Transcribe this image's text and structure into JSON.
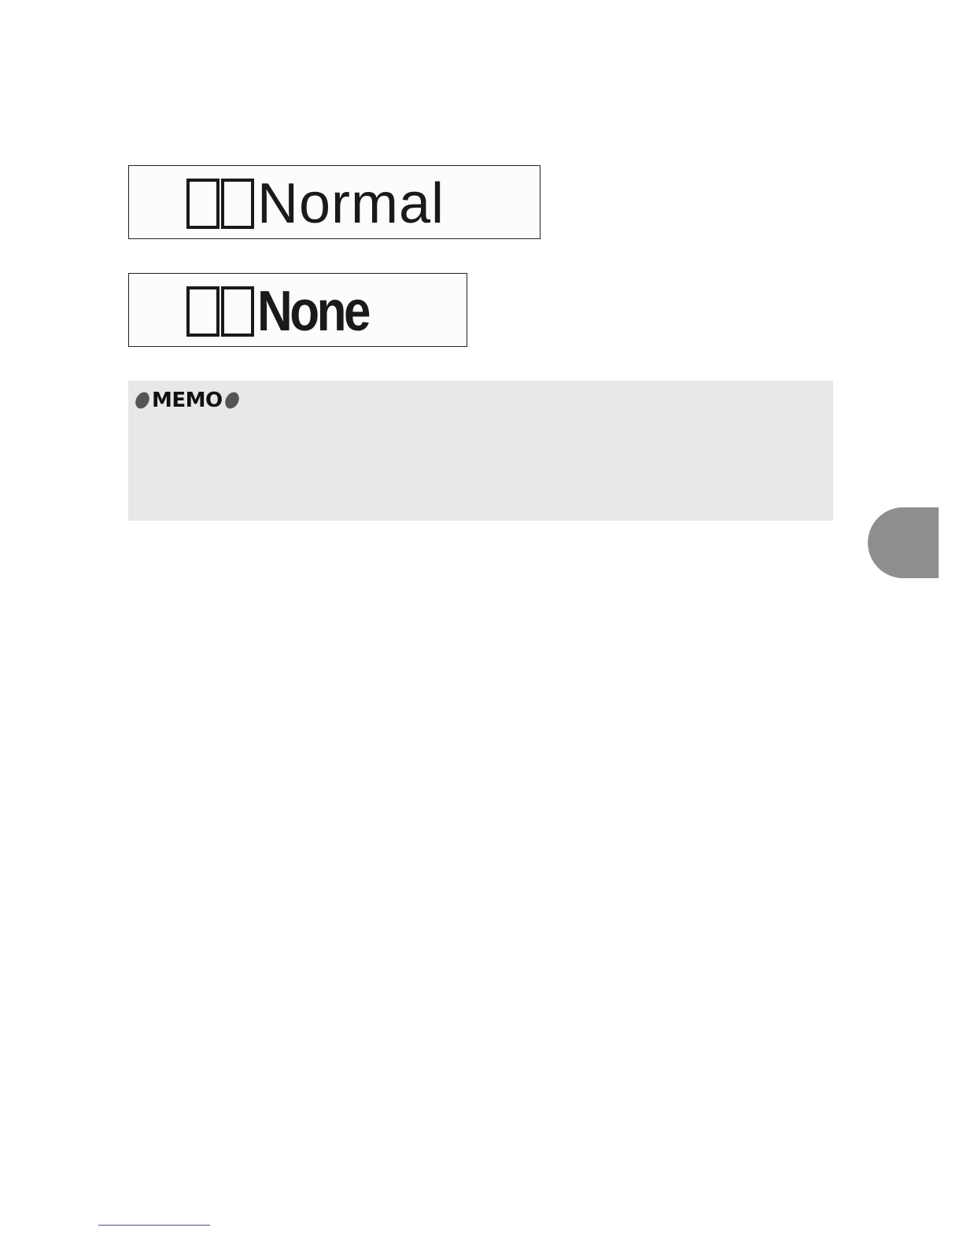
{
  "samples": [
    {
      "label": "Normal"
    },
    {
      "label": "None"
    }
  ],
  "memo": {
    "label": "MEMO",
    "body": ""
  },
  "colors": {
    "memo_background": "#e8e8e8",
    "side_tab": "#8e8e8e",
    "footer_link": "#3a4fc0"
  }
}
